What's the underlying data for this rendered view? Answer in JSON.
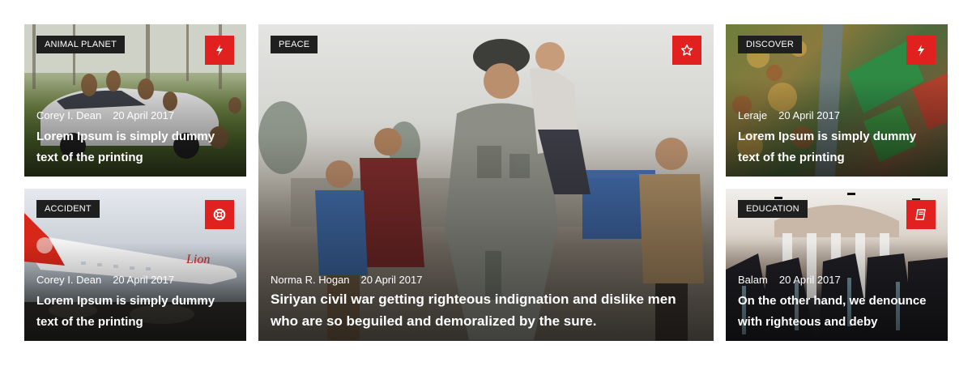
{
  "cards": [
    {
      "category": "ANIMAL PLANET",
      "icon": "lightning-icon",
      "author": "Corey I. Dean",
      "date": "20 April 2017",
      "title": "Lorem Ipsum is simply dummy text of the printing"
    },
    {
      "category": "ACCIDENT",
      "icon": "lifebuoy-icon",
      "author": "Corey I. Dean",
      "date": "20 April 2017",
      "title": "Lorem Ipsum is simply dummy text of the printing"
    },
    {
      "category": "PEACE",
      "icon": "star-icon",
      "author": "Norma R. Hogan",
      "date": "20 April 2017",
      "title": "Siriyan civil war getting righteous indignation and dislike men who are so beguiled and demoralized by the sure."
    },
    {
      "category": "DISCOVER",
      "icon": "lightning-icon",
      "author": "Leraje",
      "date": "20 April 2017",
      "title": "Lorem Ipsum is simply dummy text of the printing"
    },
    {
      "category": "EDUCATION",
      "icon": "book-icon",
      "author": "Balam",
      "date": "20 April 2017",
      "title": "On the other hand, we denounce with righteous and deby"
    }
  ],
  "colors": {
    "accent": "#e0211f",
    "badge": "#1f1f1f"
  }
}
